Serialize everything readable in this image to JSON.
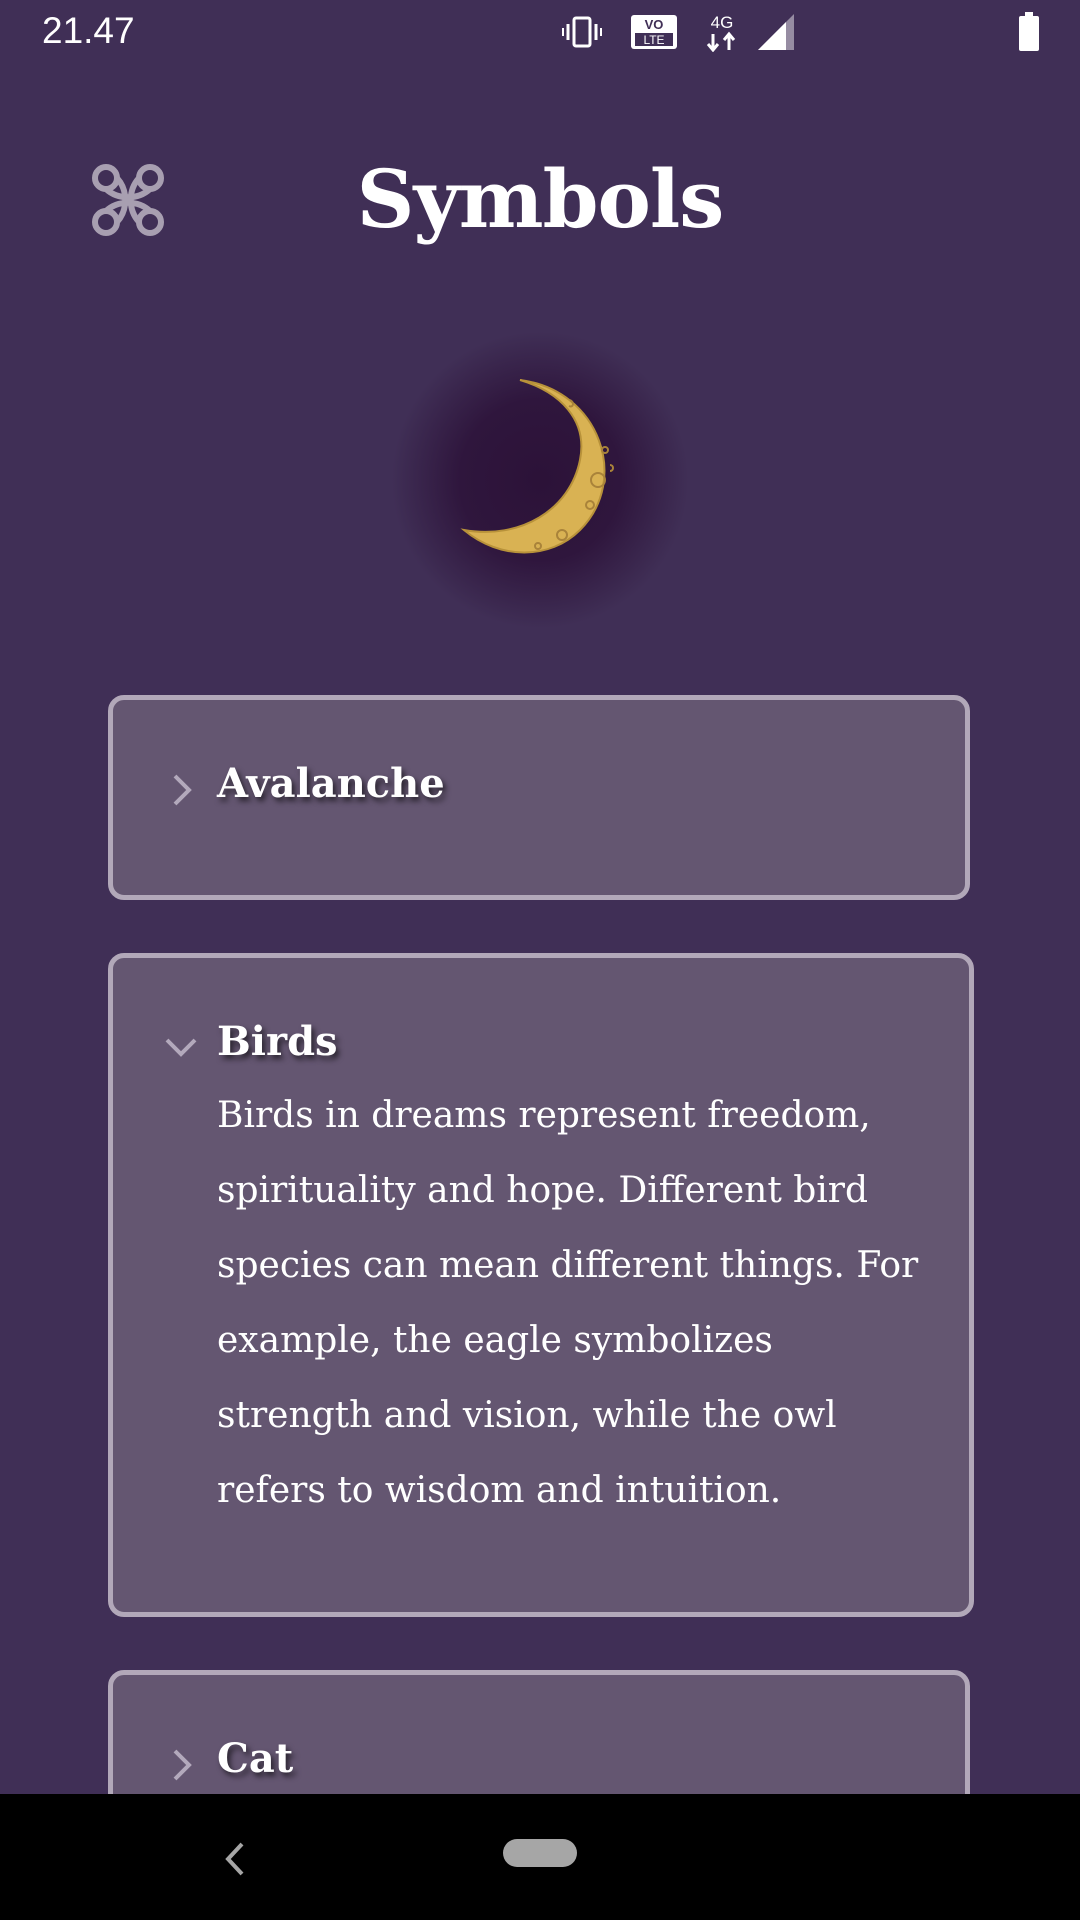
{
  "status_bar": {
    "time": "21.47",
    "icons": [
      "vibrate-icon",
      "volte-icon",
      "4g-data-icon",
      "signal-icon",
      "battery-icon"
    ],
    "volte_top": "VO",
    "volte_bottom": "LTE",
    "network": "4G"
  },
  "header": {
    "logo_icon": "celtic-knot-icon",
    "title": "Symbols"
  },
  "hero": {
    "icon": "crescent-moon-icon"
  },
  "symbols": [
    {
      "title": "Avalanche",
      "expanded": false
    },
    {
      "title": "Birds",
      "expanded": true,
      "description": "Birds in dreams represent freedom, spirituality and hope. Different bird species can mean different things. For example, the eagle symbolizes strength and vision, while the owl refers to wisdom and intuition."
    },
    {
      "title": "Cat",
      "expanded": false
    }
  ],
  "nav_bar": {
    "icons": [
      "back-icon",
      "home-pill-icon"
    ]
  },
  "colors": {
    "background": "#402f56",
    "card": "#645671",
    "card_border": "#b2a8b9",
    "moon": "#d9b253"
  }
}
